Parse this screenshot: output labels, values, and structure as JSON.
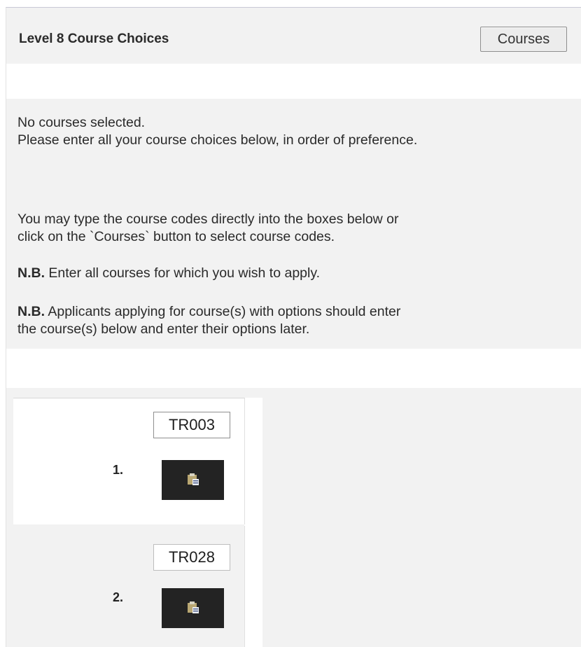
{
  "header": {
    "title": "Level 8 Course Choices",
    "courses_button": "Courses"
  },
  "info": {
    "line1": "No courses selected.",
    "line2": "Please enter all your course choices below, in order of preference.",
    "type_line1": "You may type the course codes directly into the boxes below or",
    "type_line2": "click on the `Courses` button to select course codes.",
    "nb1_label": "N.B.",
    "nb1_text": " Enter all courses for which you wish to apply.",
    "nb2_label": "N.B.",
    "nb2_line1": " Applicants applying for course(s) with options should enter",
    "nb2_line2": "the course(s) below and enter their options later."
  },
  "choices": [
    {
      "number": "1.",
      "code": "TR003",
      "icon": "clipboard-icon"
    },
    {
      "number": "2.",
      "code": "TR028",
      "icon": "clipboard-icon"
    }
  ],
  "colors": {
    "panel_bg": "#f2f2f2",
    "button_dark": "#232323"
  }
}
